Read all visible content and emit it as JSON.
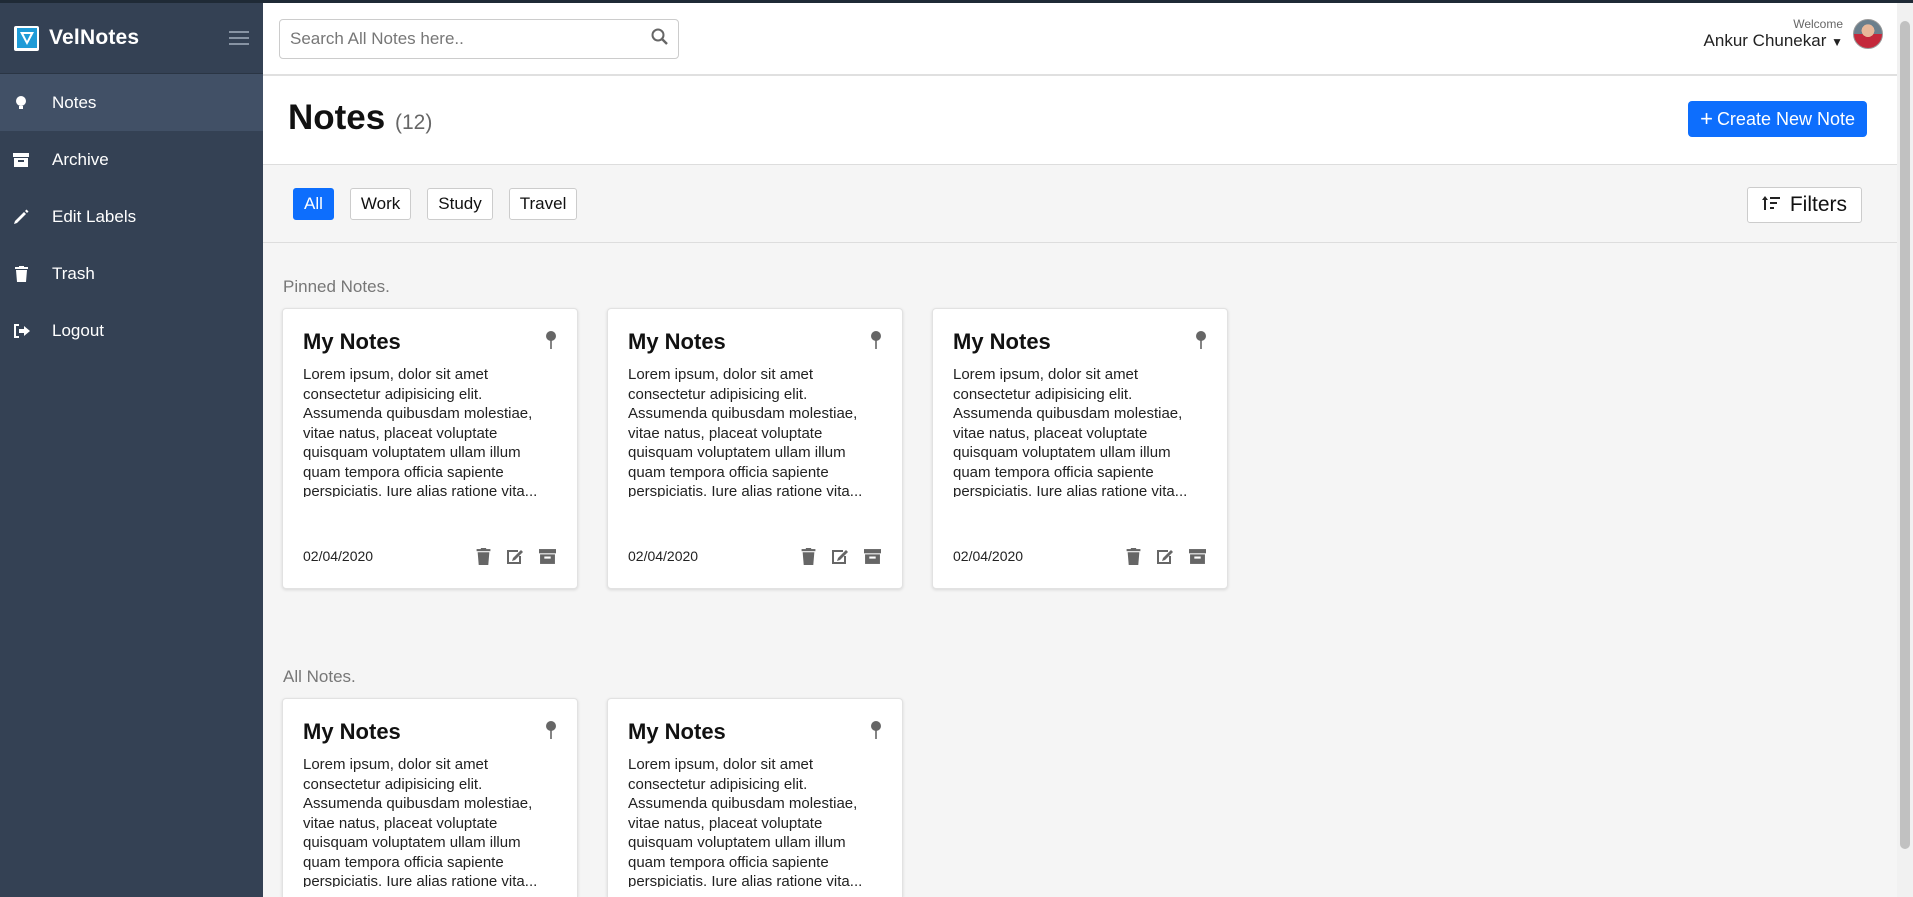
{
  "app": {
    "name": "VelNotes"
  },
  "sidebar": {
    "items": [
      {
        "label": "Notes",
        "icon": "bulb-icon",
        "active": true
      },
      {
        "label": "Archive",
        "icon": "archive-icon",
        "active": false
      },
      {
        "label": "Edit Labels",
        "icon": "pencil-icon",
        "active": false
      },
      {
        "label": "Trash",
        "icon": "trash-icon",
        "active": false
      },
      {
        "label": "Logout",
        "icon": "logout-icon",
        "active": false
      }
    ]
  },
  "header": {
    "search_placeholder": "Search All Notes here..",
    "welcome": "Welcome",
    "username": "Ankur Chunekar"
  },
  "page": {
    "title": "Notes",
    "count": "(12)",
    "create_label": "Create New Note"
  },
  "filters": {
    "chips": [
      "All",
      "Work",
      "Study",
      "Travel"
    ],
    "active": "All",
    "button_label": "Filters"
  },
  "sections": {
    "pinned_label": "Pinned Notes.",
    "all_label": "All Notes."
  },
  "notes": {
    "pinned": [
      {
        "title": "My Notes",
        "body": "Lorem ipsum, dolor sit amet consectetur adipisicing elit. Assumenda quibusdam molestiae, vitae natus, placeat voluptate quisquam voluptatem ullam illum quam tempora officia sapiente perspiciatis. Iure alias ratione vita...",
        "date": "02/04/2020"
      },
      {
        "title": "My Notes",
        "body": "Lorem ipsum, dolor sit amet consectetur adipisicing elit. Assumenda quibusdam molestiae, vitae natus, placeat voluptate quisquam voluptatem ullam illum quam tempora officia sapiente perspiciatis. Iure alias ratione vita...",
        "date": "02/04/2020"
      },
      {
        "title": "My Notes",
        "body": "Lorem ipsum, dolor sit amet consectetur adipisicing elit. Assumenda quibusdam molestiae, vitae natus, placeat voluptate quisquam voluptatem ullam illum quam tempora officia sapiente perspiciatis. Iure alias ratione vita...",
        "date": "02/04/2020"
      }
    ],
    "all": [
      {
        "title": "My Notes",
        "body": "Lorem ipsum, dolor sit amet consectetur adipisicing elit. Assumenda quibusdam molestiae, vitae natus, placeat voluptate quisquam voluptatem ullam illum quam tempora officia sapiente perspiciatis. Iure alias ratione vita..."
      },
      {
        "title": "My Notes",
        "body": "Lorem ipsum, dolor sit amet consectetur adipisicing elit. Assumenda quibusdam molestiae, vitae natus, placeat voluptate quisquam voluptatem ullam illum quam tempora officia sapiente perspiciatis. Iure alias ratione vita..."
      }
    ]
  },
  "colors": {
    "accent": "#0d6efd",
    "sidebar": "#344154",
    "sidebar_active": "#415066"
  }
}
